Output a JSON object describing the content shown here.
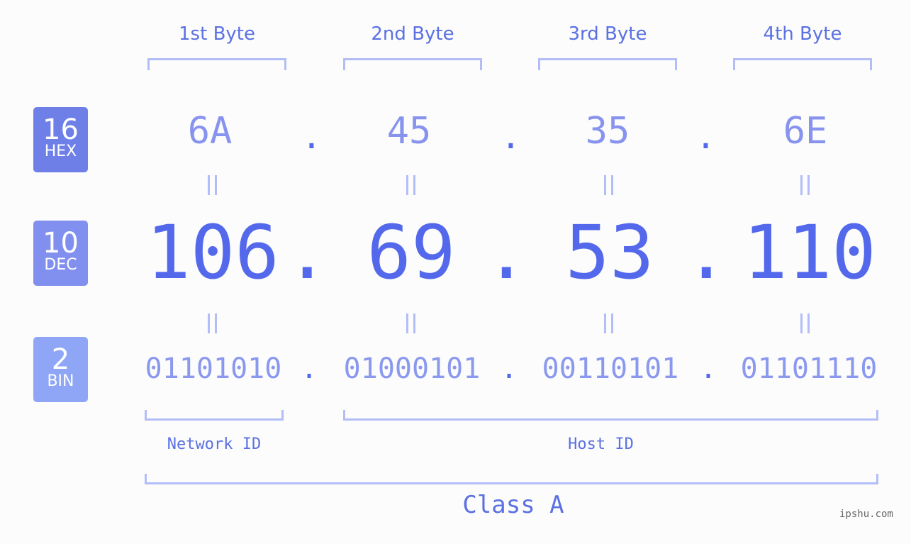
{
  "bytes": [
    {
      "label": "1st Byte",
      "hex": "6A",
      "dec": "106",
      "bin": "01101010"
    },
    {
      "label": "2nd Byte",
      "hex": "45",
      "dec": "69",
      "bin": "01000101"
    },
    {
      "label": "3rd Byte",
      "hex": "35",
      "dec": "53",
      "bin": "00110101"
    },
    {
      "label": "4th Byte",
      "hex": "6E",
      "dec": "110",
      "bin": "01101110"
    }
  ],
  "separator": ".",
  "equals": "=",
  "badges": {
    "hex": {
      "num": "16",
      "label": "HEX",
      "color": "#6f7fe8"
    },
    "dec": {
      "num": "10",
      "label": "DEC",
      "color": "#8190ee"
    },
    "bin": {
      "num": "2",
      "label": "BIN",
      "color": "#8fa6f7"
    }
  },
  "network_id_label": "Network ID",
  "host_id_label": "Host ID",
  "class_label": "Class A",
  "watermark": "ipshu.com",
  "colors": {
    "accent": "#5468ec",
    "light_accent": "#8793ee",
    "bracket": "#b3bdf7",
    "background": "#fbfcfb"
  }
}
